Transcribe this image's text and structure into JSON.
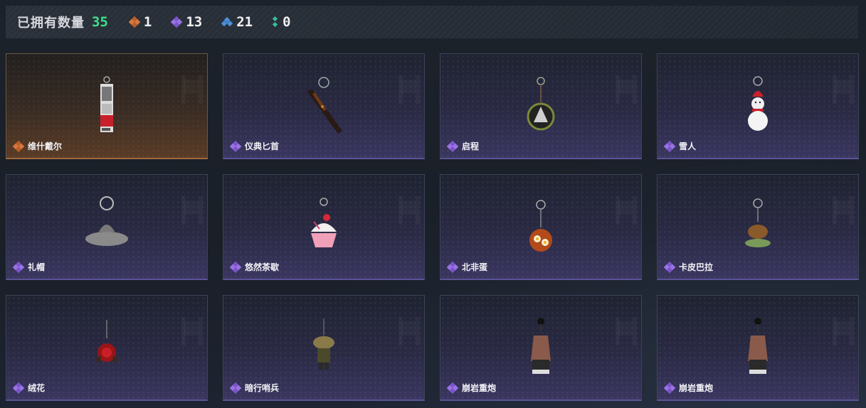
{
  "header": {
    "owned_label": "已拥有数量",
    "owned_total": "35",
    "stats": [
      {
        "icon": "orange-diamond-icon",
        "count": "1"
      },
      {
        "icon": "purple-diamond-icon",
        "count": "13"
      },
      {
        "icon": "blue-diamond-icon",
        "count": "21"
      },
      {
        "icon": "green-diamond-icon",
        "count": "0"
      }
    ]
  },
  "items": [
    {
      "name": "维什戴尔",
      "rarity": "orange",
      "charm": "card-charm"
    },
    {
      "name": "仪典匕首",
      "rarity": "purple",
      "charm": "dagger-charm"
    },
    {
      "name": "启程",
      "rarity": "purple",
      "charm": "medal-charm"
    },
    {
      "name": "雪人",
      "rarity": "purple",
      "charm": "snowman-charm"
    },
    {
      "name": "礼帽",
      "rarity": "purple",
      "charm": "hat-charm"
    },
    {
      "name": "悠然茶歇",
      "rarity": "purple",
      "charm": "cupcake-charm"
    },
    {
      "name": "北非蛋",
      "rarity": "purple",
      "charm": "shakshuka-charm"
    },
    {
      "name": "卡皮巴拉",
      "rarity": "purple",
      "charm": "capybara-charm"
    },
    {
      "name": "绒花",
      "rarity": "purple",
      "charm": "rose-charm"
    },
    {
      "name": "暗行哨兵",
      "rarity": "purple",
      "charm": "sentinel-charm"
    },
    {
      "name": "崩岩重炮",
      "rarity": "purple",
      "charm": "cannon-charm"
    },
    {
      "name": "崩岩重炮",
      "rarity": "purple",
      "charm": "cannon-charm"
    }
  ],
  "colors": {
    "accent_green": "#3fe08c",
    "orange": "#d8783e",
    "purple": "#9a72e6",
    "blue": "#4a8fd8",
    "green": "#34c0a0"
  }
}
